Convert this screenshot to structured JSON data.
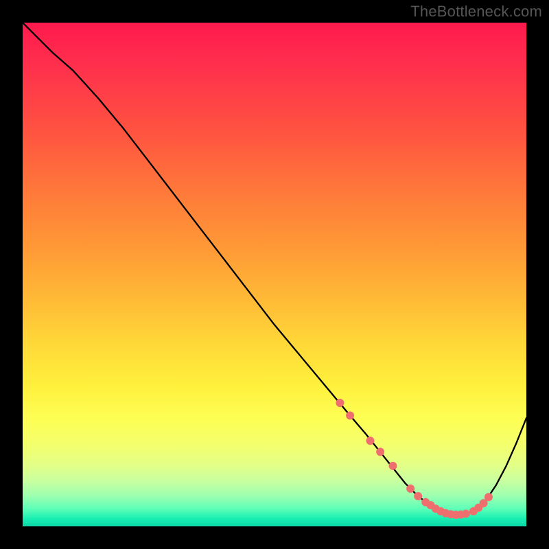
{
  "watermark": "TheBottleneck.com",
  "chart_data": {
    "type": "line",
    "title": "",
    "xlabel": "",
    "ylabel": "",
    "xlim": [
      0,
      100
    ],
    "ylim": [
      0,
      100
    ],
    "grid": false,
    "legend": false,
    "series": [
      {
        "name": "bottleneck-curve",
        "x": [
          0,
          3,
          6,
          10,
          15,
          20,
          25,
          30,
          35,
          40,
          45,
          50,
          55,
          60,
          65,
          68,
          70,
          72,
          74,
          76,
          78,
          80,
          82,
          84,
          86,
          88,
          90,
          92,
          94,
          96,
          98,
          100
        ],
        "y": [
          100,
          97,
          94,
          90.5,
          85,
          79,
          72.5,
          66,
          59.5,
          53,
          46.5,
          40,
          34,
          28,
          22,
          18.5,
          16,
          13.5,
          11,
          8.5,
          6.5,
          4.8,
          3.5,
          2.6,
          2.3,
          2.5,
          3.4,
          5.2,
          8.2,
          12,
          16.5,
          21.5
        ]
      }
    ],
    "markers": {
      "name": "highlight-dots",
      "x": [
        63,
        65,
        69,
        71,
        73.5,
        77,
        78.5,
        80,
        81,
        82,
        83,
        84,
        85,
        86,
        87,
        88,
        89.5,
        90.5,
        91.5,
        92.5
      ],
      "y": [
        24.5,
        22,
        17,
        14.8,
        12,
        7.5,
        6.0,
        4.8,
        4.2,
        3.5,
        3.0,
        2.6,
        2.4,
        2.3,
        2.35,
        2.5,
        3.0,
        3.7,
        4.6,
        5.8
      ]
    },
    "colors": {
      "curve": "#000000",
      "markers": "#ef6f6f",
      "gradient_top": "#ff1a4d",
      "gradient_mid": "#fff03c",
      "gradient_bottom": "#0bd8a8"
    }
  }
}
